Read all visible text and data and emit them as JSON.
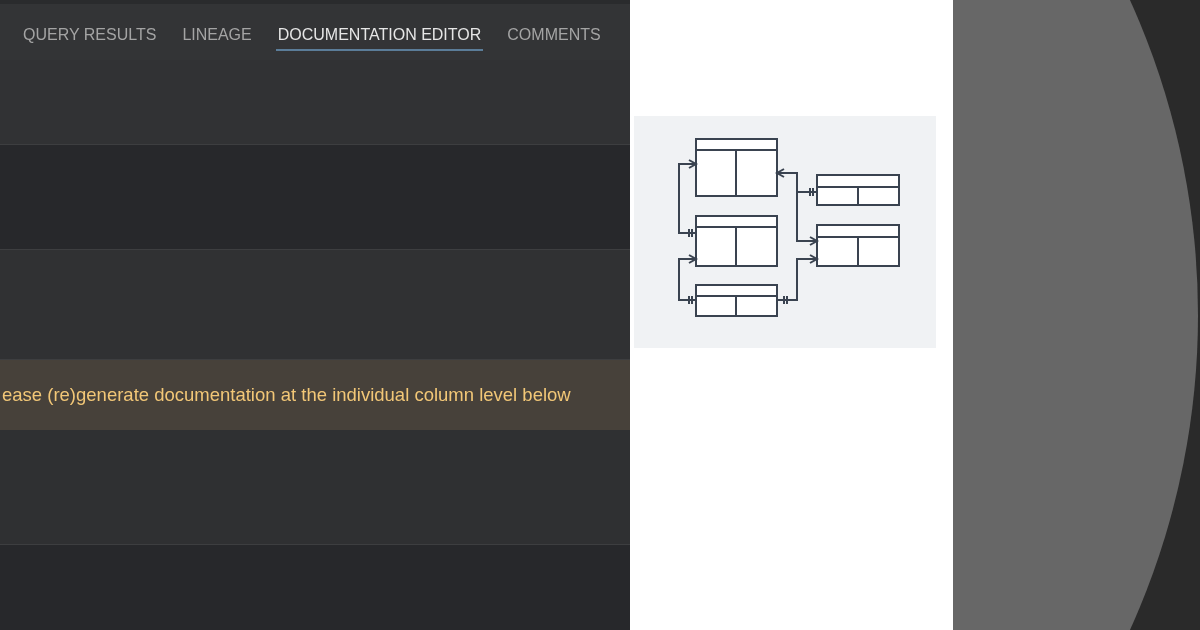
{
  "tabs": [
    {
      "label": "QUERY RESULTS",
      "selected": false
    },
    {
      "label": "LINEAGE",
      "selected": false
    },
    {
      "label": "DOCUMENTATION EDITOR",
      "selected": true
    },
    {
      "label": "COMMENTS",
      "selected": false
    }
  ],
  "notice": {
    "text": "ease (re)generate documentation at the individual column level below"
  }
}
